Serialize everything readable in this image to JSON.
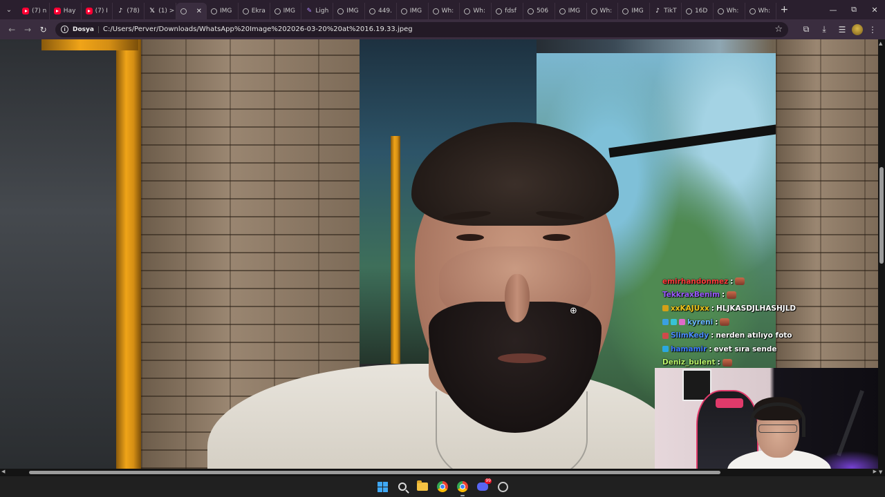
{
  "browser": {
    "tabs": [
      {
        "icon": "youtube-icon",
        "label": "(7) n"
      },
      {
        "icon": "youtube-icon",
        "label": "Hay"
      },
      {
        "icon": "youtube-icon",
        "label": "(7) I"
      },
      {
        "icon": "tiktok-icon",
        "label": "(78)"
      },
      {
        "icon": "x-icon",
        "label": "(1) >"
      },
      {
        "icon": "globe-icon",
        "label": "",
        "active": true
      },
      {
        "icon": "globe-icon",
        "label": "IMG"
      },
      {
        "icon": "globe-icon",
        "label": "Ekra"
      },
      {
        "icon": "globe-icon",
        "label": "IMG"
      },
      {
        "icon": "pen-icon",
        "label": "Ligh"
      },
      {
        "icon": "globe-icon",
        "label": "IMG"
      },
      {
        "icon": "globe-icon",
        "label": "449."
      },
      {
        "icon": "globe-icon",
        "label": "IMG"
      },
      {
        "icon": "globe-icon",
        "label": "Wh:"
      },
      {
        "icon": "globe-icon",
        "label": "Wh:"
      },
      {
        "icon": "globe-icon",
        "label": "fdsf"
      },
      {
        "icon": "globe-icon",
        "label": "506"
      },
      {
        "icon": "globe-icon",
        "label": "IMG"
      },
      {
        "icon": "globe-icon",
        "label": "Wh:"
      },
      {
        "icon": "globe-icon",
        "label": "IMG"
      },
      {
        "icon": "tiktok-icon",
        "label": "TikT"
      },
      {
        "icon": "globe-icon",
        "label": "16D"
      },
      {
        "icon": "globe-icon",
        "label": "Wh:"
      },
      {
        "icon": "globe-icon",
        "label": "Wh:"
      }
    ],
    "newtab_glyph": "+",
    "window_controls": {
      "minimize": "—",
      "restore": "⧉",
      "close": "✕"
    },
    "address": {
      "chip": "Dosya",
      "url": "C:/Users/Perver/Downloads/WhatsApp%20Image%202026-03-20%20at%2016.19.33.jpeg"
    },
    "glyphs": {
      "back": "←",
      "forward": "→",
      "reload": "↻",
      "star": "☆",
      "tab_close": "✕",
      "menu": "⋮",
      "tab_search": "⌄",
      "extensions": "⧉",
      "downloads": "⤓",
      "media": "☰",
      "info": "i"
    }
  },
  "chat": {
    "messages": [
      {
        "user": "emirhandonmez",
        "text": "",
        "user_color": "#ff3b3b",
        "badges": [],
        "emote": true
      },
      {
        "user": "TekkraxBenim",
        "text": "",
        "user_color": "#9b59ff",
        "badges": [],
        "emote": true
      },
      {
        "user": "xxKAJUxx",
        "text": "HLJKASDJLHASHJLD",
        "user_color": "#f0c419",
        "badges": [
          "#d4a017"
        ],
        "emote": false
      },
      {
        "user": "kyreni",
        "text": "",
        "user_color": "#6ab8ff",
        "badges": [
          "#3aa0e0",
          "#37c3d6",
          "#e06ac8"
        ],
        "emote": true
      },
      {
        "user": "SlimKedy",
        "text": "nerden atılıyo foto",
        "user_color": "#4a8cff",
        "badges": [
          "#d04a4a"
        ],
        "emote": false
      },
      {
        "user": "hamamir",
        "text": "evet sıra sende",
        "user_color": "#3c7bff",
        "badges": [
          "#2aa8e0"
        ],
        "emote": false
      },
      {
        "user": "Deniz_bulent",
        "text": "",
        "user_color": "#b8f26a",
        "badges": [],
        "emote": true
      }
    ]
  },
  "taskbar": {
    "apps": [
      "windows-start-icon",
      "search-icon",
      "file-explorer-icon",
      "chrome-icon",
      "chrome-active-icon",
      "discord-icon",
      "app-icon"
    ],
    "discord_badge": "99",
    "accent": "#3fa8f5"
  }
}
